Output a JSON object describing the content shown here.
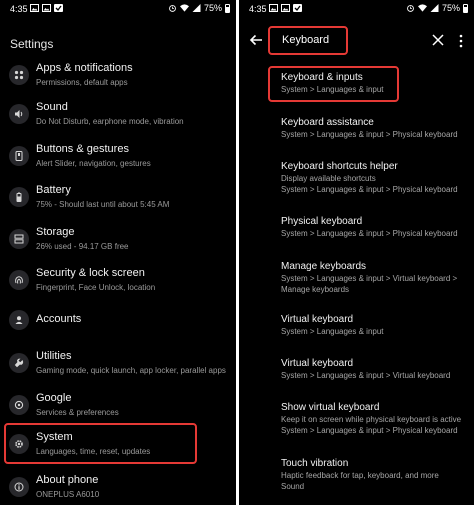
{
  "left": {
    "status": {
      "time": "4:35",
      "battery": "75%"
    },
    "title": "Settings",
    "items": [
      {
        "title": "Apps & notifications",
        "subtitle": "Permissions, default apps",
        "icon": "apps-icon"
      },
      {
        "title": "Sound",
        "subtitle": "Do Not Disturb, earphone mode, vibration",
        "icon": "sound-icon"
      },
      {
        "title": "Buttons & gestures",
        "subtitle": "Alert Slider, navigation, gestures",
        "icon": "buttons-icon"
      },
      {
        "title": "Battery",
        "subtitle": "75% - Should last until about 5:45 AM",
        "icon": "battery-icon"
      },
      {
        "title": "Storage",
        "subtitle": "26% used - 94.17 GB free",
        "icon": "storage-icon"
      },
      {
        "title": "Security & lock screen",
        "subtitle": "Fingerprint, Face Unlock, location",
        "icon": "fingerprint-icon"
      },
      {
        "title": "Accounts",
        "subtitle": "",
        "icon": "accounts-icon"
      },
      {
        "title": "Utilities",
        "subtitle": "Gaming mode, quick launch, app locker, parallel apps",
        "icon": "utilities-icon"
      },
      {
        "title": "Google",
        "subtitle": "Services & preferences",
        "icon": "google-icon"
      },
      {
        "title": "System",
        "subtitle": "Languages, time, reset, updates",
        "icon": "system-gear-icon"
      },
      {
        "title": "About phone",
        "subtitle": "ONEPLUS A6010",
        "icon": "info-icon"
      }
    ]
  },
  "right": {
    "status": {
      "time": "4:35",
      "battery": "75%"
    },
    "search_query": "Keyboard",
    "results": [
      {
        "title": "Keyboard & inputs",
        "lines": [
          "System > Languages & input"
        ]
      },
      {
        "title": "Keyboard assistance",
        "lines": [
          "System > Languages & input > Physical keyboard"
        ]
      },
      {
        "title": "Keyboard shortcuts helper",
        "lines": [
          "Display available shortcuts",
          "System > Languages & input > Physical keyboard"
        ]
      },
      {
        "title": "Physical keyboard",
        "lines": [
          "System > Languages & input > Physical keyboard"
        ]
      },
      {
        "title": "Manage keyboards",
        "lines": [
          "System > Languages & input > Virtual keyboard >",
          "Manage keyboards"
        ]
      },
      {
        "title": "Virtual keyboard",
        "lines": [
          "System > Languages & input"
        ]
      },
      {
        "title": "Virtual keyboard",
        "lines": [
          "System > Languages & input > Virtual keyboard"
        ]
      },
      {
        "title": "Show virtual keyboard",
        "lines": [
          "Keep it on screen while physical keyboard is active",
          "System > Languages & input > Physical keyboard"
        ]
      },
      {
        "title": "Touch vibration",
        "lines": [
          "Haptic feedback for tap, keyboard, and more",
          "Sound"
        ]
      }
    ]
  },
  "colors": {
    "background": "#000000",
    "highlight": "#e53935",
    "icon_bg": "#27272b"
  }
}
